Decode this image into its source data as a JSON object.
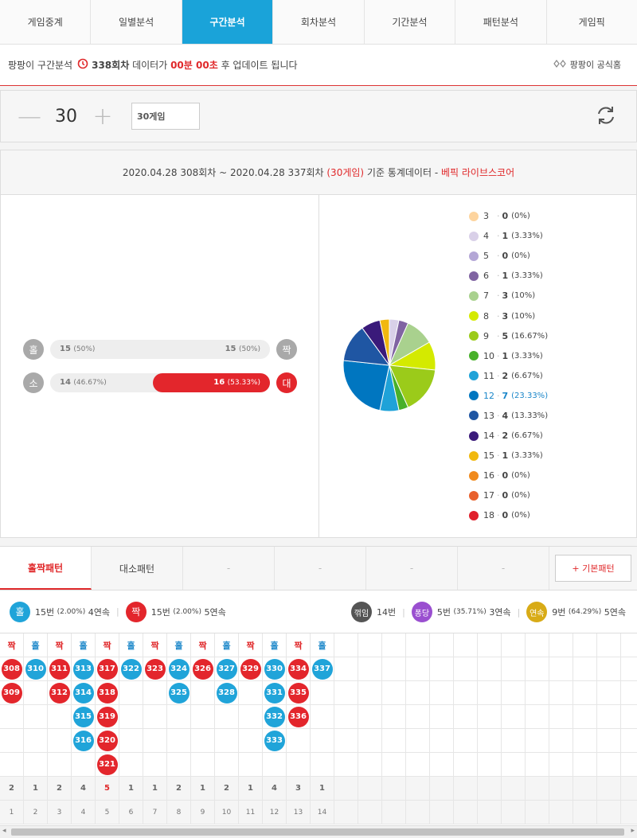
{
  "tabs": [
    {
      "label": "게임중계",
      "active": false
    },
    {
      "label": "일별분석",
      "active": false
    },
    {
      "label": "구간분석",
      "active": true
    },
    {
      "label": "회차분석",
      "active": false
    },
    {
      "label": "기간분석",
      "active": false
    },
    {
      "label": "패턴분석",
      "active": false
    },
    {
      "label": "게임픽",
      "active": false
    }
  ],
  "notice": {
    "prefix": "팡팡이 구간분석",
    "round": "338회차",
    "mid": "데이터가",
    "time": "00분 00초",
    "suffix": "후 업데이트 됩니다",
    "home_link": "팡팡이 공식홈"
  },
  "control": {
    "count": "30",
    "select_value": "30게임",
    "minus": "—",
    "plus": "+"
  },
  "stats": {
    "range_text": "2020.04.28 308회차 ~ 2020.04.28 337회차",
    "games_text": "(30게임)",
    "base_text": "기준 통계데이터 -",
    "source_text": "베픽 라이브스코어",
    "odd_even": {
      "left_badge": "홀",
      "left_count": "15",
      "left_pct": "(50%)",
      "right_badge": "짝",
      "right_count": "15",
      "right_pct": "(50%)",
      "right_fraction": 0.5,
      "highlight": false
    },
    "small_big": {
      "left_badge": "소",
      "left_count": "14",
      "left_pct": "(46.67%)",
      "right_badge": "대",
      "right_count": "16",
      "right_pct": "(53.33%)",
      "right_fraction": 0.5333,
      "highlight": true
    }
  },
  "chart_data": {
    "type": "pie",
    "categories": [
      "3",
      "4",
      "5",
      "6",
      "7",
      "8",
      "9",
      "10",
      "11",
      "12",
      "13",
      "14",
      "15",
      "16",
      "17",
      "18"
    ],
    "values": [
      0,
      1,
      0,
      1,
      3,
      3,
      5,
      1,
      2,
      7,
      4,
      2,
      1,
      0,
      0,
      0
    ],
    "percent_labels": [
      "(0%)",
      "(3.33%)",
      "(0%)",
      "(3.33%)",
      "(10%)",
      "(10%)",
      "(16.67%)",
      "(3.33%)",
      "(6.67%)",
      "(23.33%)",
      "(13.33%)",
      "(6.67%)",
      "(3.33%)",
      "(0%)",
      "(0%)",
      "(0%)"
    ],
    "colors": [
      "#fdd49e",
      "#d9d0e8",
      "#b4a7d6",
      "#8064a2",
      "#a9d18e",
      "#d4ea00",
      "#9bcb1a",
      "#48b02a",
      "#1fa2d8",
      "#0076c0",
      "#1f56a3",
      "#3a1a7a",
      "#f1b80f",
      "#f08a1d",
      "#e8602c",
      "#e0202b"
    ],
    "highlight": "12",
    "legend": "right"
  },
  "pattern": {
    "tabs": [
      "홀짝패턴",
      "대소패턴",
      "-",
      "-",
      "-",
      "-"
    ],
    "basic_button": "+ 기본패턴",
    "summary": {
      "odd_badge": "홀",
      "odd_text": "15번",
      "odd_pct": "(2.00%)",
      "odd_streak": "4연속",
      "even_badge": "짝",
      "even_text": "15번",
      "even_pct": "(2.00%)",
      "even_streak": "5연속",
      "break_badge": "꺾임",
      "break_text": "14번",
      "pong_badge": "퐁당",
      "pong_text": "5번",
      "pong_pct": "(35.71%)",
      "pong_streak": "3연속",
      "cont_badge": "연속",
      "cont_text": "9번",
      "cont_pct": "(64.29%)",
      "cont_streak": "5연속"
    },
    "columns": [
      {
        "head": "짝",
        "kind": "even",
        "balls": [
          "308",
          "309"
        ],
        "count": "2",
        "index": "1"
      },
      {
        "head": "홀",
        "kind": "odd",
        "balls": [
          "310"
        ],
        "count": "1",
        "index": "2"
      },
      {
        "head": "짝",
        "kind": "even",
        "balls": [
          "311",
          "312"
        ],
        "count": "2",
        "index": "3"
      },
      {
        "head": "홀",
        "kind": "odd",
        "balls": [
          "313",
          "314",
          "315",
          "316"
        ],
        "count": "4",
        "index": "4"
      },
      {
        "head": "짝",
        "kind": "even",
        "balls": [
          "317",
          "318",
          "319",
          "320",
          "321"
        ],
        "count": "5",
        "index": "5",
        "max": true
      },
      {
        "head": "홀",
        "kind": "odd",
        "balls": [
          "322"
        ],
        "count": "1",
        "index": "6"
      },
      {
        "head": "짝",
        "kind": "even",
        "balls": [
          "323"
        ],
        "count": "1",
        "index": "7"
      },
      {
        "head": "홀",
        "kind": "odd",
        "balls": [
          "324",
          "325"
        ],
        "count": "2",
        "index": "8"
      },
      {
        "head": "짝",
        "kind": "even",
        "balls": [
          "326"
        ],
        "count": "1",
        "index": "9"
      },
      {
        "head": "홀",
        "kind": "odd",
        "balls": [
          "327",
          "328"
        ],
        "count": "2",
        "index": "10"
      },
      {
        "head": "짝",
        "kind": "even",
        "balls": [
          "329"
        ],
        "count": "1",
        "index": "11"
      },
      {
        "head": "홀",
        "kind": "odd",
        "balls": [
          "330",
          "331",
          "332",
          "333"
        ],
        "count": "4",
        "index": "12"
      },
      {
        "head": "짝",
        "kind": "even",
        "balls": [
          "334",
          "335",
          "336"
        ],
        "count": "3",
        "index": "13"
      },
      {
        "head": "홀",
        "kind": "odd",
        "balls": [
          "337"
        ],
        "count": "1",
        "index": "14"
      }
    ]
  },
  "colors": {
    "accent": "#1aa3d9",
    "red": "#e3262c",
    "blue": "#20a4d9"
  }
}
